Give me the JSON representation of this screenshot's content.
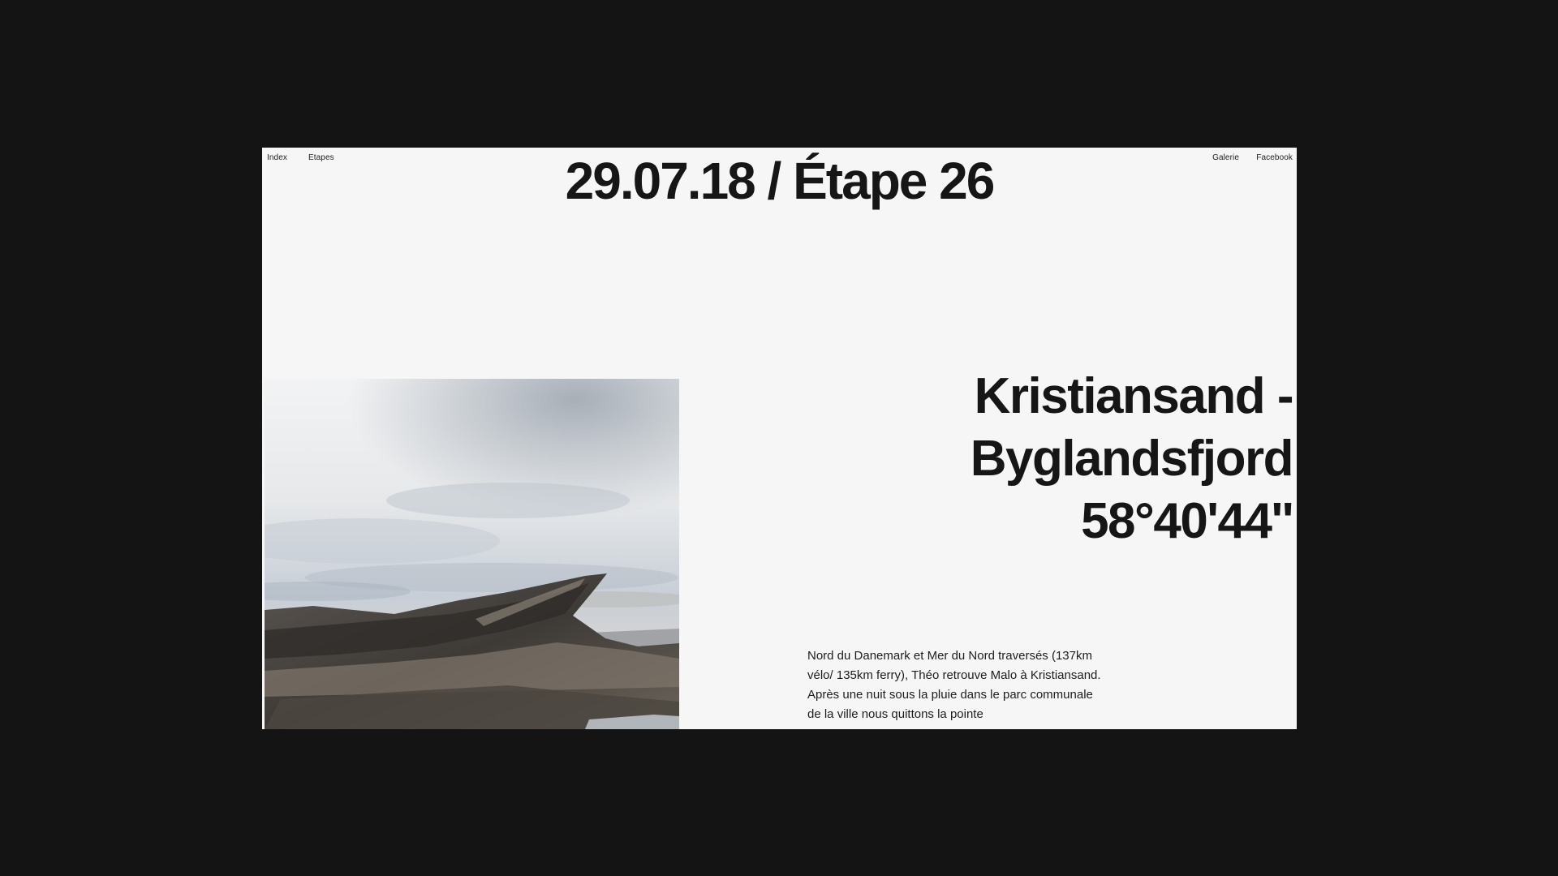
{
  "nav": {
    "left": [
      "Index",
      "Etapes"
    ],
    "right": [
      "Galerie",
      "Facebook"
    ]
  },
  "header": {
    "title": "29.07.18 / Étape 26"
  },
  "stage": {
    "route_line1": "Kristiansand -",
    "route_line2": "Byglandsfjord",
    "coordinates": "58°40'44''"
  },
  "photo": {
    "subject": "rocky-coastline-photo"
  },
  "description": {
    "text": "Nord du Danemark et Mer du Nord traversés (137km vélo/ 135km ferry), Théo retrouve Malo à Kristiansand. Après une nuit sous la pluie dans le parc communale de la ville nous quittons la pointe"
  },
  "colors": {
    "page_background": "#141414",
    "site_background": "#f6f6f6",
    "text": "#161616"
  }
}
